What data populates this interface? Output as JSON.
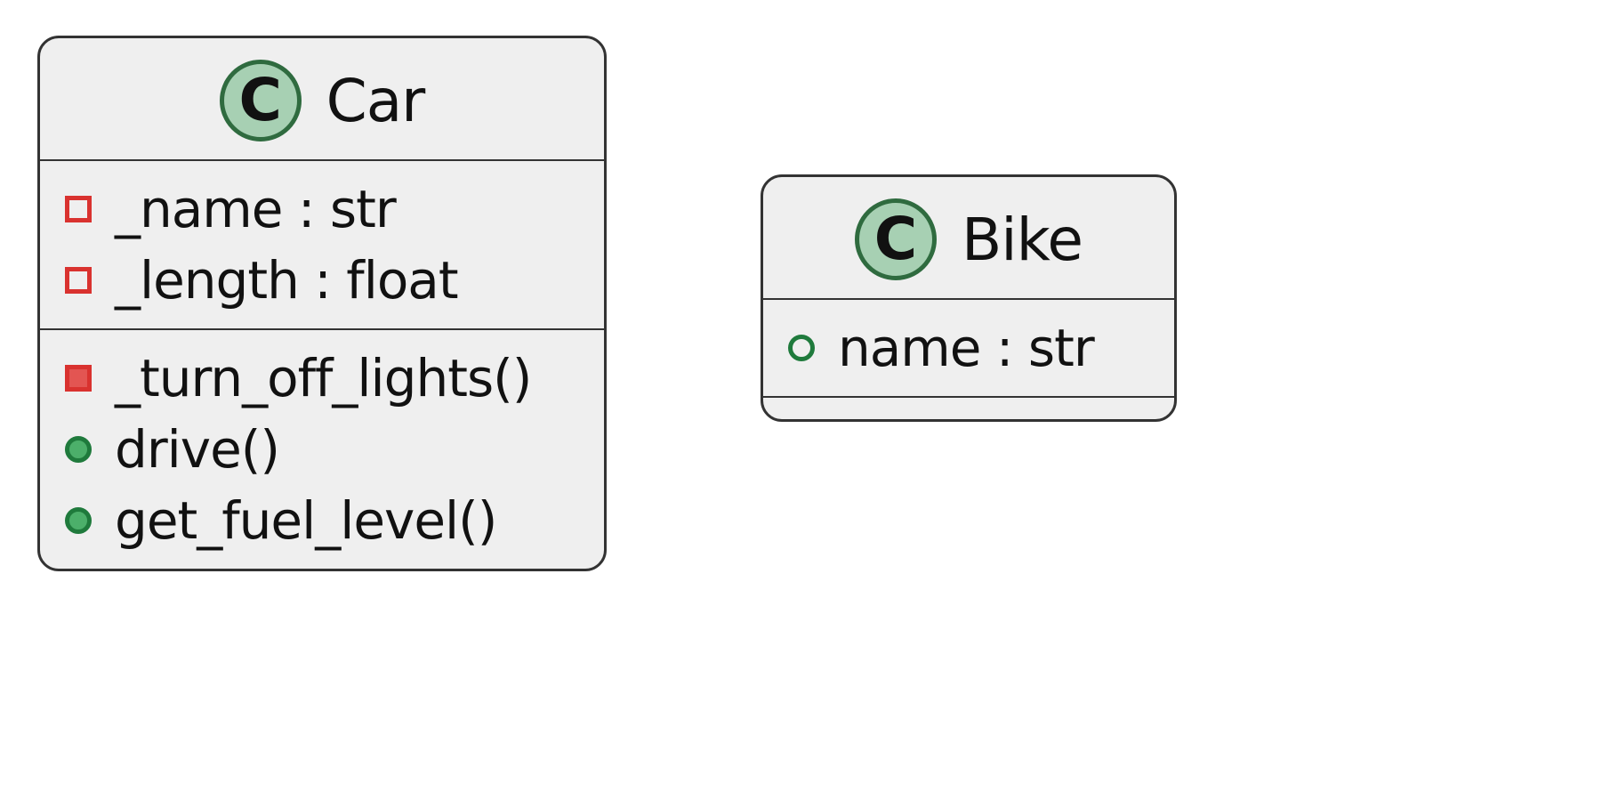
{
  "classes": {
    "car": {
      "badge": "C",
      "name": "Car",
      "attributes": [
        {
          "visibility": "protected-attr",
          "text": "_name : str"
        },
        {
          "visibility": "protected-attr",
          "text": "_length : float"
        }
      ],
      "methods": [
        {
          "visibility": "protected-method",
          "text": "_turn_off_lights()"
        },
        {
          "visibility": "public-method",
          "text": "drive()"
        },
        {
          "visibility": "public-method",
          "text": "get_fuel_level()"
        }
      ]
    },
    "bike": {
      "badge": "C",
      "name": "Bike",
      "attributes": [
        {
          "visibility": "public-attr",
          "text": "name : str"
        }
      ],
      "methods": []
    }
  }
}
